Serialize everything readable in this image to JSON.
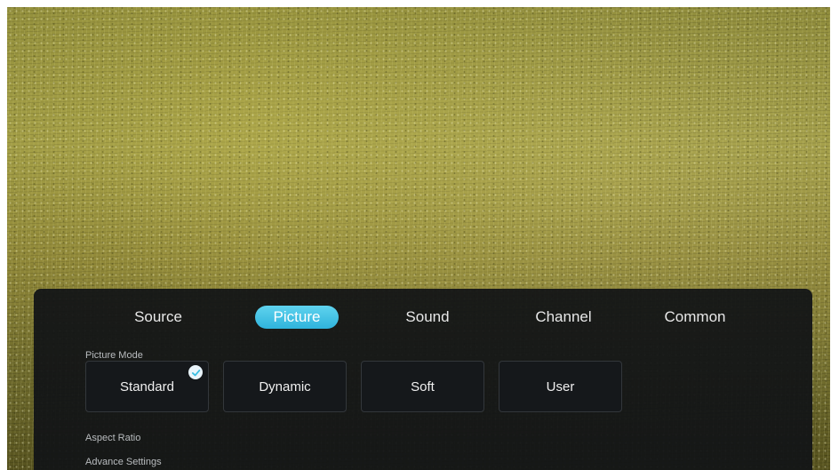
{
  "tabs": [
    {
      "label": "Source"
    },
    {
      "label": "Picture",
      "active": true
    },
    {
      "label": "Sound"
    },
    {
      "label": "Channel"
    },
    {
      "label": "Common"
    }
  ],
  "picture_mode": {
    "label": "Picture Mode",
    "options": [
      {
        "label": "Standard",
        "selected": true
      },
      {
        "label": "Dynamic"
      },
      {
        "label": "Soft"
      },
      {
        "label": "User"
      }
    ]
  },
  "aspect_ratio": {
    "label": "Aspect Ratio"
  },
  "advance_settings": {
    "label": "Advance Settings"
  },
  "colors": {
    "accent": "#3bbfe3",
    "panel": "#121416"
  },
  "icons": {
    "selected_check": "check-icon"
  }
}
